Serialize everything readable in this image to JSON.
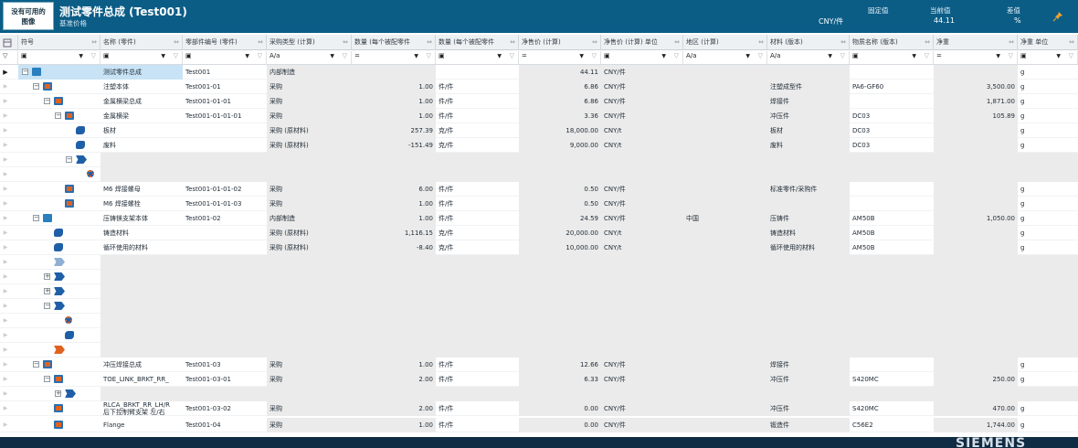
{
  "header": {
    "no_image": "没有可用的\n图像",
    "title": "测试零件总成 (Test001)",
    "subtitle": "基准价格",
    "unit": "CNY/件",
    "fixed_label": "固定值",
    "current_label": "当前值",
    "current_value": "44.11",
    "diff_label": "差值",
    "diff_value": "%"
  },
  "columns": [
    {
      "label": "符号"
    },
    {
      "label": "名称 (零件)"
    },
    {
      "label": "零部件编号 (零件)"
    },
    {
      "label": "采购类型 (计算)"
    },
    {
      "label": "数量 (每个被配零件"
    },
    {
      "label": "数量 (每个被配零件"
    },
    {
      "label": "净售价 (计算)"
    },
    {
      "label": "净售价 (计算) 单位"
    },
    {
      "label": "地区 (计算)"
    },
    {
      "label": "材料 (版本)"
    },
    {
      "label": "物质名称 (版本)"
    },
    {
      "label": "净重"
    },
    {
      "label": "净重 单位"
    }
  ],
  "filters": [
    "▣",
    "▣",
    "▣",
    "A/a",
    "=",
    "▣",
    "=",
    "▣",
    "A/a",
    "A/a",
    "▣",
    "=",
    "▣"
  ],
  "rows": [
    {
      "name": "测试零件总成",
      "num": "Test001",
      "proc": "内部制造",
      "qty": "",
      "qunit": "",
      "price": "44.11",
      "punit": "CNY/件",
      "region": "",
      "mat": "",
      "sub": "",
      "wt": "",
      "wunit": "g"
    },
    {
      "name": "注塑本体",
      "num": "Test001-01",
      "proc": "采购",
      "qty": "1.00",
      "qunit": "件/件",
      "price": "6.86",
      "punit": "CNY/件",
      "region": "",
      "mat": "注塑成型件",
      "sub": "PA6-GF60",
      "wt": "3,500.00",
      "wunit": "g"
    },
    {
      "name": "金属横梁总成",
      "num": "Test001-01-01",
      "proc": "采购",
      "qty": "1.00",
      "qunit": "件/件",
      "price": "6.86",
      "punit": "CNY/件",
      "region": "",
      "mat": "焊接件",
      "sub": "",
      "wt": "1,871.00",
      "wunit": "g"
    },
    {
      "name": "金属横梁",
      "num": "Test001-01-01-01",
      "proc": "采购",
      "qty": "1.00",
      "qunit": "件/件",
      "price": "3.36",
      "punit": "CNY/件",
      "region": "",
      "mat": "冲压件",
      "sub": "DC03",
      "wt": "105.89",
      "wunit": "g"
    },
    {
      "name": "板材",
      "num": "",
      "proc": "采购 (原材料)",
      "qty": "257.39",
      "qunit": "克/件",
      "price": "18,000.00",
      "punit": "CNY/t",
      "region": "",
      "mat": "板材",
      "sub": "DC03",
      "wt": "",
      "wunit": "g"
    },
    {
      "name": "废料",
      "num": "",
      "proc": "采购 (原材料)",
      "qty": "-151.49",
      "qunit": "克/件",
      "price": "9,000.00",
      "punit": "CNY/t",
      "region": "",
      "mat": "废料",
      "sub": "DC03",
      "wt": "",
      "wunit": "g"
    },
    {
      "name": "",
      "num": "",
      "proc": "",
      "qty": "",
      "qunit": "",
      "price": "",
      "punit": "",
      "region": "",
      "mat": "",
      "sub": "",
      "wt": "",
      "wunit": ""
    },
    {
      "name": "",
      "num": "",
      "proc": "",
      "qty": "",
      "qunit": "",
      "price": "",
      "punit": "",
      "region": "",
      "mat": "",
      "sub": "",
      "wt": "",
      "wunit": ""
    },
    {
      "name": "M6 焊接螺母",
      "num": "Test001-01-01-02",
      "proc": "采购",
      "qty": "6.00",
      "qunit": "件/件",
      "price": "0.50",
      "punit": "CNY/件",
      "region": "",
      "mat": "标准零件/采购件",
      "sub": "",
      "wt": "",
      "wunit": "g"
    },
    {
      "name": "M6 焊接螺栓",
      "num": "Test001-01-01-03",
      "proc": "采购",
      "qty": "1.00",
      "qunit": "件/件",
      "price": "0.50",
      "punit": "CNY/件",
      "region": "",
      "mat": "",
      "sub": "",
      "wt": "",
      "wunit": "g"
    },
    {
      "name": "压铸镁支架本体",
      "num": "Test001-02",
      "proc": "内部制造",
      "qty": "1.00",
      "qunit": "件/件",
      "price": "24.59",
      "punit": "CNY/件",
      "region": "中国",
      "mat": "压铸件",
      "sub": "AM50B",
      "wt": "1,050.00",
      "wunit": "g"
    },
    {
      "name": "铸造材料",
      "num": "",
      "proc": "采购 (原材料)",
      "qty": "1,116.15",
      "qunit": "克/件",
      "price": "20,000.00",
      "punit": "CNY/t",
      "region": "",
      "mat": "铸造材料",
      "sub": "AM50B",
      "wt": "",
      "wunit": "g"
    },
    {
      "name": "循环使用的材料",
      "num": "",
      "proc": "采购 (原材料)",
      "qty": "-8.40",
      "qunit": "克/件",
      "price": "10,000.00",
      "punit": "CNY/t",
      "region": "",
      "mat": "循环使用的材料",
      "sub": "AM50B",
      "wt": "",
      "wunit": "g"
    },
    {
      "name": "",
      "num": "",
      "proc": "",
      "qty": "",
      "qunit": "",
      "price": "",
      "punit": "",
      "region": "",
      "mat": "",
      "sub": "",
      "wt": "",
      "wunit": ""
    },
    {
      "name": "",
      "num": "",
      "proc": "",
      "qty": "",
      "qunit": "",
      "price": "",
      "punit": "",
      "region": "",
      "mat": "",
      "sub": "",
      "wt": "",
      "wunit": ""
    },
    {
      "name": "",
      "num": "",
      "proc": "",
      "qty": "",
      "qunit": "",
      "price": "",
      "punit": "",
      "region": "",
      "mat": "",
      "sub": "",
      "wt": "",
      "wunit": ""
    },
    {
      "name": "",
      "num": "",
      "proc": "",
      "qty": "",
      "qunit": "",
      "price": "",
      "punit": "",
      "region": "",
      "mat": "",
      "sub": "",
      "wt": "",
      "wunit": ""
    },
    {
      "name": "",
      "num": "",
      "proc": "",
      "qty": "",
      "qunit": "",
      "price": "",
      "punit": "",
      "region": "",
      "mat": "",
      "sub": "",
      "wt": "",
      "wunit": ""
    },
    {
      "name": "",
      "num": "",
      "proc": "",
      "qty": "",
      "qunit": "",
      "price": "",
      "punit": "",
      "region": "",
      "mat": "",
      "sub": "",
      "wt": "",
      "wunit": ""
    },
    {
      "name": "",
      "num": "",
      "proc": "",
      "qty": "",
      "qunit": "",
      "price": "",
      "punit": "",
      "region": "",
      "mat": "",
      "sub": "",
      "wt": "",
      "wunit": ""
    },
    {
      "name": "冲压焊接总成",
      "num": "Test001-03",
      "proc": "采购",
      "qty": "1.00",
      "qunit": "件/件",
      "price": "12.66",
      "punit": "CNY/件",
      "region": "",
      "mat": "焊接件",
      "sub": "",
      "wt": "",
      "wunit": "g"
    },
    {
      "name": "TOE_LINK_BRKT_RR_",
      "num": "Test001-03-01",
      "proc": "采购",
      "qty": "2.00",
      "qunit": "件/件",
      "price": "6.33",
      "punit": "CNY/件",
      "region": "",
      "mat": "冲压件",
      "sub": "S420MC",
      "wt": "250.00",
      "wunit": "g"
    },
    {
      "name": "",
      "num": "",
      "proc": "",
      "qty": "",
      "qunit": "",
      "price": "",
      "punit": "",
      "region": "",
      "mat": "",
      "sub": "",
      "wt": "",
      "wunit": ""
    },
    {
      "name": "RLCA_BRKT_RR_LH/R\n后下控制臂支架 左/右",
      "num": "Test001-03-02",
      "proc": "采购",
      "qty": "2.00",
      "qunit": "件/件",
      "price": "0.00",
      "punit": "CNY/件",
      "region": "",
      "mat": "冲压件",
      "sub": "S420MC",
      "wt": "470.00",
      "wunit": "g"
    },
    {
      "name": "Flange",
      "num": "Test001-04",
      "proc": "采购",
      "qty": "1.00",
      "qunit": "件/件",
      "price": "0.00",
      "punit": "CNY/件",
      "region": "",
      "mat": "锻造件",
      "sub": "C56E2",
      "wt": "1,744.00",
      "wunit": "g"
    }
  ],
  "brand": "SIEMENS"
}
